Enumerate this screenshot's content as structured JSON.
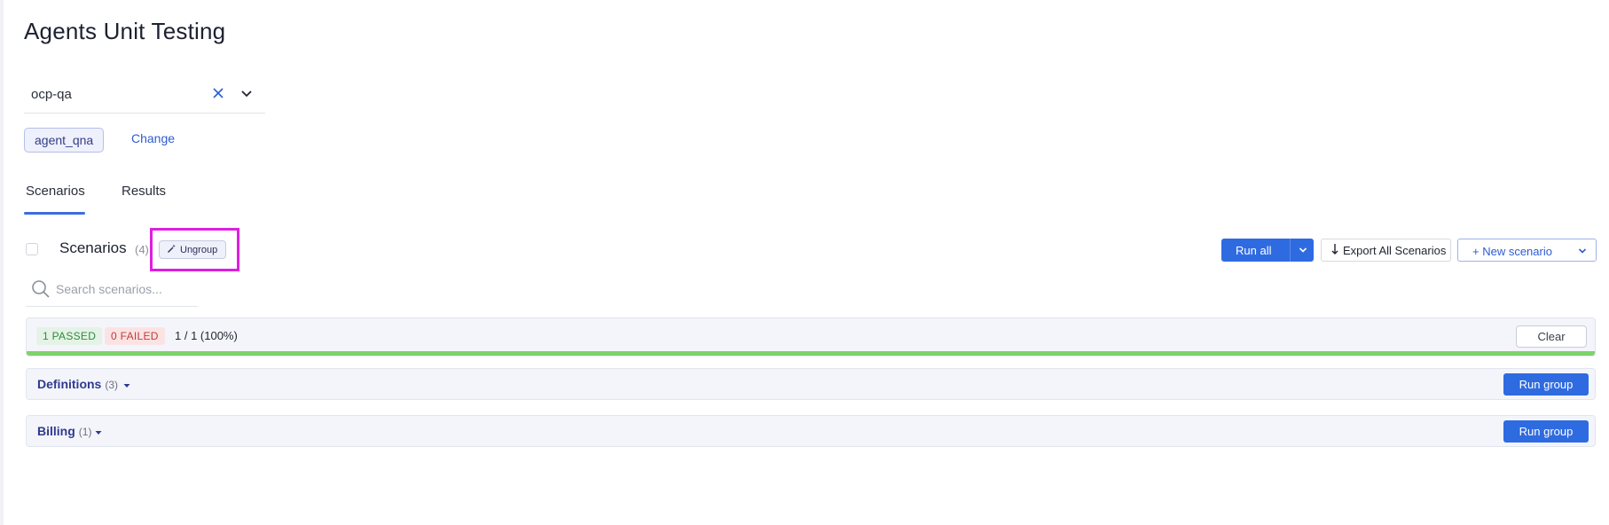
{
  "page": {
    "title": "Agents Unit Testing"
  },
  "project_select": {
    "value": "ocp-qa",
    "clear_icon": "close-icon",
    "expand_icon": "chevron-down-icon"
  },
  "agent": {
    "chip_label": "agent_qna",
    "change_label": "Change"
  },
  "tabs": [
    {
      "label": "Scenarios",
      "active": true
    },
    {
      "label": "Results",
      "active": false
    }
  ],
  "scenarios": {
    "title": "Scenarios",
    "count": "(4)",
    "ungroup_label": "Ungroup",
    "ungroup_icon": "magic-wand-icon",
    "search_placeholder": "Search scenarios...",
    "search_icon": "search-icon"
  },
  "toolbar": {
    "run_all_label": "Run all",
    "export_label": "Export All Scenarios",
    "export_icon": "download-arrow-icon",
    "new_scenario_label": "+ New scenario"
  },
  "results": {
    "passed_label": "1 PASSED",
    "failed_label": "0 FAILED",
    "ratio_text": "1 / 1 (100%)",
    "progress_fraction": 1.0,
    "clear_label": "Clear"
  },
  "groups": [
    {
      "name": "Definitions",
      "count": "(3)",
      "run_label": "Run group"
    },
    {
      "name": "Billing",
      "count": "(1)",
      "run_label": "Run group"
    }
  ],
  "colors": {
    "accent": "#2f6be0",
    "highlight": "#e01ee0",
    "passed": "#2f8a3e",
    "failed": "#c23a3a",
    "progress": "#7ed36a"
  }
}
